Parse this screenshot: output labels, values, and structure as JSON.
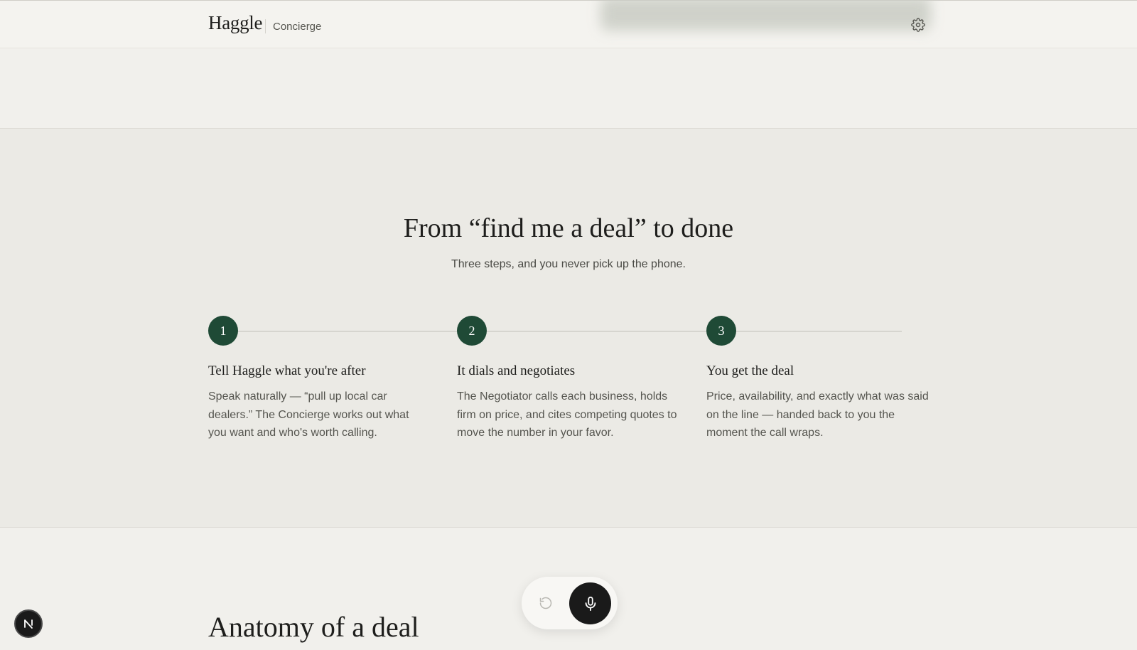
{
  "header": {
    "brand": "Haggle",
    "subtitle": "Concierge",
    "settings_icon": "gear-icon"
  },
  "how_it_works": {
    "title": "From “find me a deal” to done",
    "subtitle": "Three steps, and you never pick up the phone.",
    "steps": [
      {
        "number": "1",
        "title": "Tell Haggle what you're after",
        "description": "Speak naturally — “pull up local car dealers.” The Concierge works out what you want and who's worth calling."
      },
      {
        "number": "2",
        "title": "It dials and negotiates",
        "description": "The Negotiator calls each business, holds firm on price, and cites competing quotes to move the number in your favor."
      },
      {
        "number": "3",
        "title": "You get the deal",
        "description": "Price, availability, and exactly what was said on the line — handed back to you the moment the call wraps."
      }
    ]
  },
  "anatomy": {
    "title": "Anatomy of a deal"
  },
  "voice_controls": {
    "reset_icon": "reset-icon",
    "mic_icon": "microphone-icon"
  },
  "dev_badge": {
    "label": "N"
  },
  "colors": {
    "accent": "#1f4a36",
    "background": "#f1f0ec",
    "section_background": "#ebeae5",
    "mic_button": "#1a1a1a"
  }
}
